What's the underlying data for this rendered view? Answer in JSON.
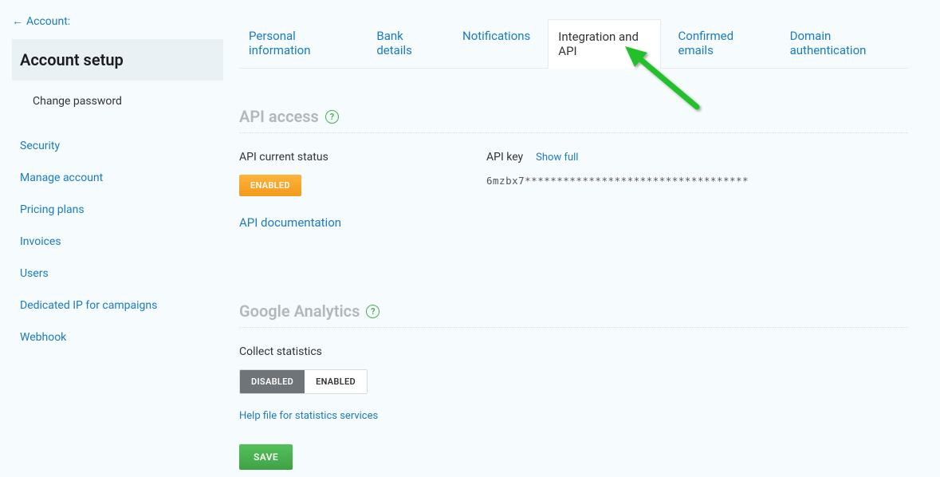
{
  "sidebar": {
    "back_label": "Account:",
    "selected_label": "Account setup",
    "sub_label": "Change password",
    "items": [
      "Security",
      "Manage account",
      "Pricing plans",
      "Invoices",
      "Users",
      "Dedicated IP for campaigns",
      "Webhook"
    ]
  },
  "tabs": {
    "personal": "Personal information",
    "bank": "Bank details",
    "notifications": "Notifications",
    "integration": "Integration and API",
    "confirmed": "Confirmed emails",
    "domain": "Domain authentication"
  },
  "api": {
    "section_title": "API access",
    "status_label": "API current status",
    "status_value": "ENABLED",
    "key_label": "API key",
    "show_full": "Show full",
    "key_value": "6mzbx7***********************************",
    "doc_link": "API documentation"
  },
  "ga": {
    "section_title": "Google Analytics",
    "collect_label": "Collect statistics",
    "disabled": "DISABLED",
    "enabled": "ENABLED",
    "help_link": "Help file for statistics services",
    "save": "SAVE"
  }
}
